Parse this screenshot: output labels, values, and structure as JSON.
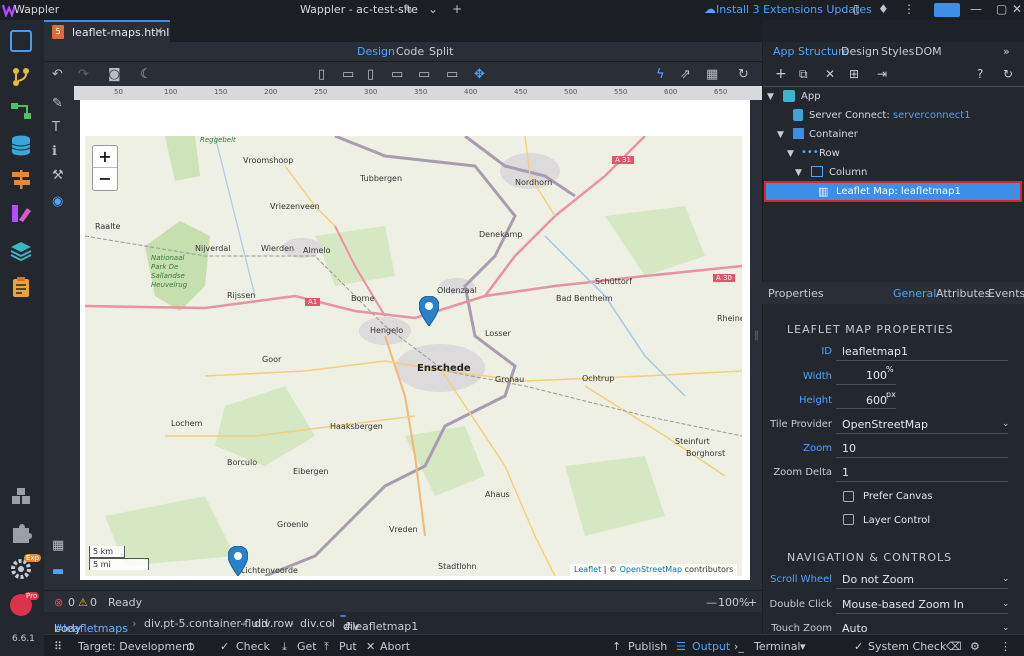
{
  "app": {
    "name": "Wappler",
    "window_title": "Wappler - ac-test-site",
    "updates": "Install 3 Extensions Updates",
    "version": "6.6.1",
    "exp_badge": "Exp",
    "pro_badge": "Pro"
  },
  "tab": {
    "file": "leaflet-maps.html",
    "badge": "5"
  },
  "views": {
    "design": "Design",
    "code": "Code",
    "split": "Split"
  },
  "ruler": [
    "50",
    "100",
    "150",
    "200",
    "250",
    "300",
    "350",
    "400",
    "450",
    "500",
    "550",
    "600",
    "650"
  ],
  "map": {
    "places": [
      {
        "name": "Vroomshoop"
      },
      {
        "name": "Tubbergen"
      },
      {
        "name": "Nordhorn"
      },
      {
        "name": "Vriezenveen"
      },
      {
        "name": "Denekamp"
      },
      {
        "name": "Raalte"
      },
      {
        "name": "Nijverdal"
      },
      {
        "name": "Wierden"
      },
      {
        "name": "Almelo"
      },
      {
        "name": "Nationaal Park De Sallandse Heuvelrug"
      },
      {
        "name": "Oldenzaal"
      },
      {
        "name": "Schüttorf"
      },
      {
        "name": "Rijssen"
      },
      {
        "name": "Borne"
      },
      {
        "name": "Bad Bentheim"
      },
      {
        "name": "Hengelo"
      },
      {
        "name": "Losser"
      },
      {
        "name": "Rheine"
      },
      {
        "name": "Goor"
      },
      {
        "name": "Enschede"
      },
      {
        "name": "Gronau"
      },
      {
        "name": "Ochtrup"
      },
      {
        "name": "Lochem"
      },
      {
        "name": "Haaksbergen"
      },
      {
        "name": "Steinfurt"
      },
      {
        "name": "Borghorst"
      },
      {
        "name": "Borculo"
      },
      {
        "name": "Eibergen"
      },
      {
        "name": "Ahaus"
      },
      {
        "name": "Groenlo"
      },
      {
        "name": "Vreden"
      },
      {
        "name": "Stadtlohn"
      },
      {
        "name": "Lichtenvoorde"
      },
      {
        "name": "Reggebelt"
      }
    ],
    "roads": [
      "A 31",
      "A 30",
      "A1"
    ],
    "zoom_in": "+",
    "zoom_out": "−",
    "scale_km": "5 km",
    "scale_mi": "5 mi",
    "attrib_leaflet": "Leaflet",
    "attrib_sep": " | © ",
    "attrib_osm": "OpenStreetMap",
    "attrib_tail": " contributors"
  },
  "status": {
    "errors": "0",
    "warnings": "0",
    "text": "Ready",
    "zoom": "100%"
  },
  "breadcrumb": [
    {
      "tag": "body",
      "id": "#leafletmaps"
    },
    {
      "tag": "div.pt-5.container-fluid",
      "id": ""
    },
    {
      "tag": "div.row",
      "id": ""
    },
    {
      "tag": "div.col",
      "id": ""
    },
    {
      "tag": "div",
      "id": "#leafletmap1"
    }
  ],
  "bottom": {
    "target": "Target: Development",
    "check": "Check",
    "get": "Get",
    "put": "Put",
    "abort": "Abort",
    "publish": "Publish",
    "output": "Output",
    "terminal": "Terminal",
    "system_check": "System Check"
  },
  "panel_tabs": {
    "app_structure": "App Structure",
    "design": "Design",
    "styles": "Styles",
    "dom": "DOM"
  },
  "tree": {
    "app": "App",
    "sc_label": "Server Connect:",
    "sc_value": "serverconnect1",
    "container": "Container",
    "row": "Row",
    "column": "Column",
    "leaflet": "Leaflet Map: leafletmap1"
  },
  "props_tabs": {
    "properties": "Properties",
    "general": "General",
    "attributes": "Attributes",
    "events": "Events"
  },
  "leaflet_props": {
    "header": "LEAFLET MAP PROPERTIES",
    "id_label": "ID",
    "id_value": "leafletmap1",
    "width_label": "Width",
    "width_value": "100",
    "width_unit": "%",
    "height_label": "Height",
    "height_value": "600",
    "height_unit": "px",
    "tile_label": "Tile Provider",
    "tile_value": "OpenStreetMap",
    "zoom_label": "Zoom",
    "zoom_value": "10",
    "zoomdelta_label": "Zoom Delta",
    "zoomdelta_value": "1",
    "prefer_canvas": "Prefer Canvas",
    "layer_control": "Layer Control"
  },
  "nav_props": {
    "header": "NAVIGATION & CONTROLS",
    "scroll_label": "Scroll Wheel",
    "scroll_value": "Do not Zoom",
    "dbl_label": "Double Click",
    "dbl_value": "Mouse-based Zoom In",
    "touch_label": "Touch Zoom",
    "touch_value": "Auto"
  },
  "colors": {
    "accent": "#3d8ee6",
    "selection_border": "#e0202a",
    "marker": "#2a81cb",
    "map_bg": "#eef0e3"
  }
}
